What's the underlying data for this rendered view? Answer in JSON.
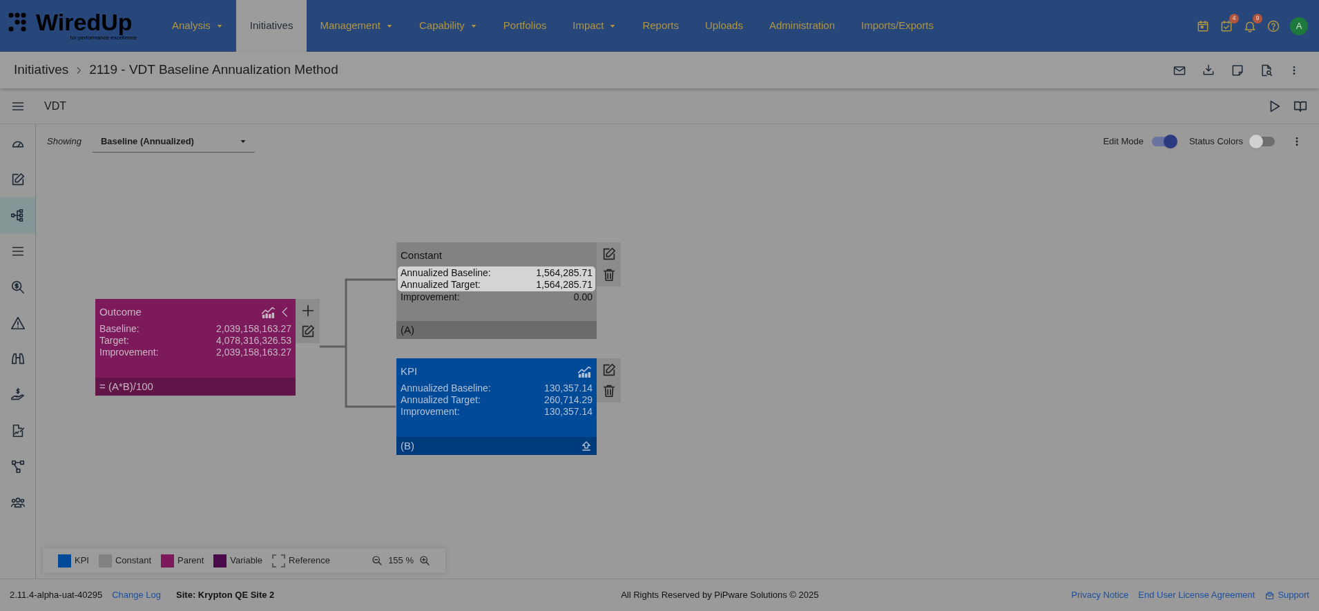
{
  "header": {
    "logo": {
      "name": "WiredUp",
      "tagline": "for performance excellence"
    },
    "nav": [
      {
        "label": "Analysis",
        "selected": false,
        "dropdown": true
      },
      {
        "label": "Initiatives",
        "selected": true,
        "dropdown": false
      },
      {
        "label": "Management",
        "selected": false,
        "dropdown": true
      },
      {
        "label": "Capability",
        "selected": false,
        "dropdown": true
      },
      {
        "label": "Portfolios",
        "selected": false,
        "dropdown": false
      },
      {
        "label": "Impact",
        "selected": false,
        "dropdown": true
      },
      {
        "label": "Reports",
        "selected": false,
        "dropdown": false
      },
      {
        "label": "Uploads",
        "selected": false,
        "dropdown": false
      },
      {
        "label": "Administration",
        "selected": false,
        "dropdown": false
      },
      {
        "label": "Imports/Exports",
        "selected": false,
        "dropdown": false
      }
    ],
    "tasks_badge": "4",
    "notifications_badge": "9",
    "avatar": "A"
  },
  "breadcrumb": [
    "Initiatives",
    "2119 - VDT Baseline Annualization Method"
  ],
  "toolbar": {
    "title": "VDT"
  },
  "sidebar": {
    "items": [
      {
        "selected": false
      },
      {
        "selected": false
      },
      {
        "selected": true
      },
      {
        "selected": false
      },
      {
        "selected": false
      },
      {
        "selected": false
      },
      {
        "selected": false
      },
      {
        "selected": false
      },
      {
        "selected": false
      },
      {
        "selected": false
      },
      {
        "selected": false
      }
    ]
  },
  "filter": {
    "label": "Showing",
    "value": "Baseline (Annualized)"
  },
  "toggles": [
    {
      "label": "Edit Mode",
      "on": true
    },
    {
      "label": "Status Colors",
      "on": false
    }
  ],
  "nodes": [
    {
      "kind": "parent",
      "title": "Outcome",
      "rows": [
        {
          "label": "Baseline:",
          "value": "2,039,158,163.27",
          "highlighted": false
        },
        {
          "label": "Target:",
          "value": "4,078,316,326.53",
          "highlighted": false
        },
        {
          "label": "Improvement:",
          "value": "2,039,158,163.27",
          "highlighted": false
        }
      ],
      "footer": "= (A*B)/100"
    },
    {
      "kind": "constant",
      "title": "Constant",
      "rows": [
        {
          "label": "Annualized Baseline:",
          "value": "1,564,285.71",
          "highlighted": true
        },
        {
          "label": "Annualized Target:",
          "value": "1,564,285.71",
          "highlighted": true
        },
        {
          "label": "Improvement:",
          "value": "0.00",
          "highlighted": false
        }
      ],
      "footer": "(A)"
    },
    {
      "kind": "kpi",
      "title": "KPI",
      "rows": [
        {
          "label": "Annualized Baseline:",
          "value": "130,357.14",
          "highlighted": false
        },
        {
          "label": "Annualized Target:",
          "value": "260,714.29",
          "highlighted": false
        },
        {
          "label": "Improvement:",
          "value": "130,357.14",
          "highlighted": false
        }
      ],
      "footer": "(B)"
    }
  ],
  "legend": [
    {
      "label": "KPI",
      "color": "#004a98",
      "kind": "solid"
    },
    {
      "label": "Constant",
      "color": "#828282",
      "kind": "solid"
    },
    {
      "label": "Parent",
      "color": "#7d1a5c",
      "kind": "solid"
    },
    {
      "label": "Variable",
      "color": "#4a0a4a",
      "kind": "solid"
    },
    {
      "label": "Reference",
      "color": "#5a5a5a",
      "kind": "dashed"
    }
  ],
  "zoom": "155 %",
  "footer": {
    "version": "2.11.4-alpha-uat-40295",
    "changelog": "Change Log",
    "site": "Site: Krypton QE Site 2",
    "copyright": "All Rights Reserved by PiPware Solutions © 2025",
    "links": [
      "Privacy Notice",
      "End User License Agreement"
    ],
    "support": "Support"
  }
}
